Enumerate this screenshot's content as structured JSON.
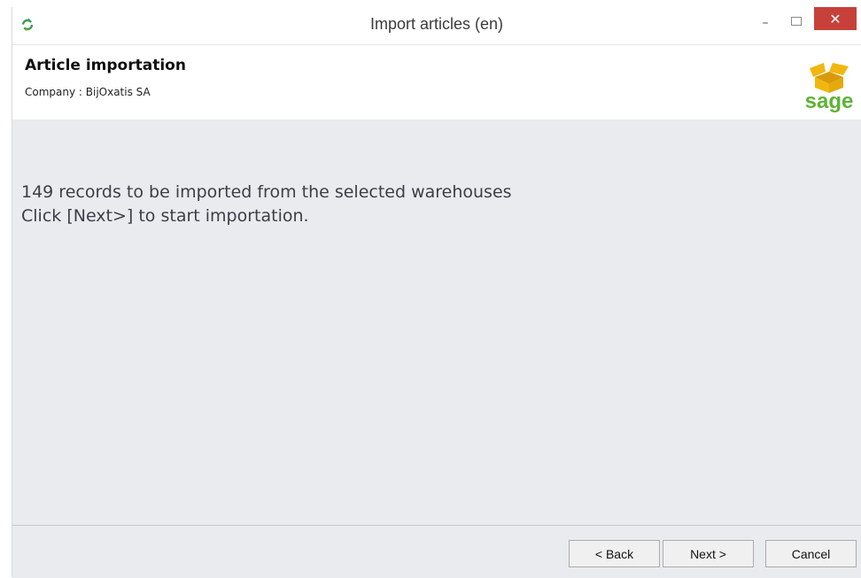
{
  "window": {
    "title": "Import articles (en)",
    "close_glyph": "✕",
    "minimize_glyph": "–"
  },
  "header": {
    "title": "Article importation",
    "subtitle": "Company : BijOxatis SA",
    "logo_text": "sage",
    "logo_color": "#5fb334",
    "logo_box_color": "#f2b70e"
  },
  "content": {
    "line1": "149 records to be imported from the selected warehouses",
    "line2": "Click [Next>] to start importation."
  },
  "buttons": {
    "back": "< Back",
    "next": "Next >",
    "cancel": "Cancel"
  },
  "icons": {
    "app": "refresh-icon",
    "close": "close-icon",
    "minimize": "minimize-icon",
    "maximize": "maximize-icon",
    "logo": "sage-logo"
  }
}
